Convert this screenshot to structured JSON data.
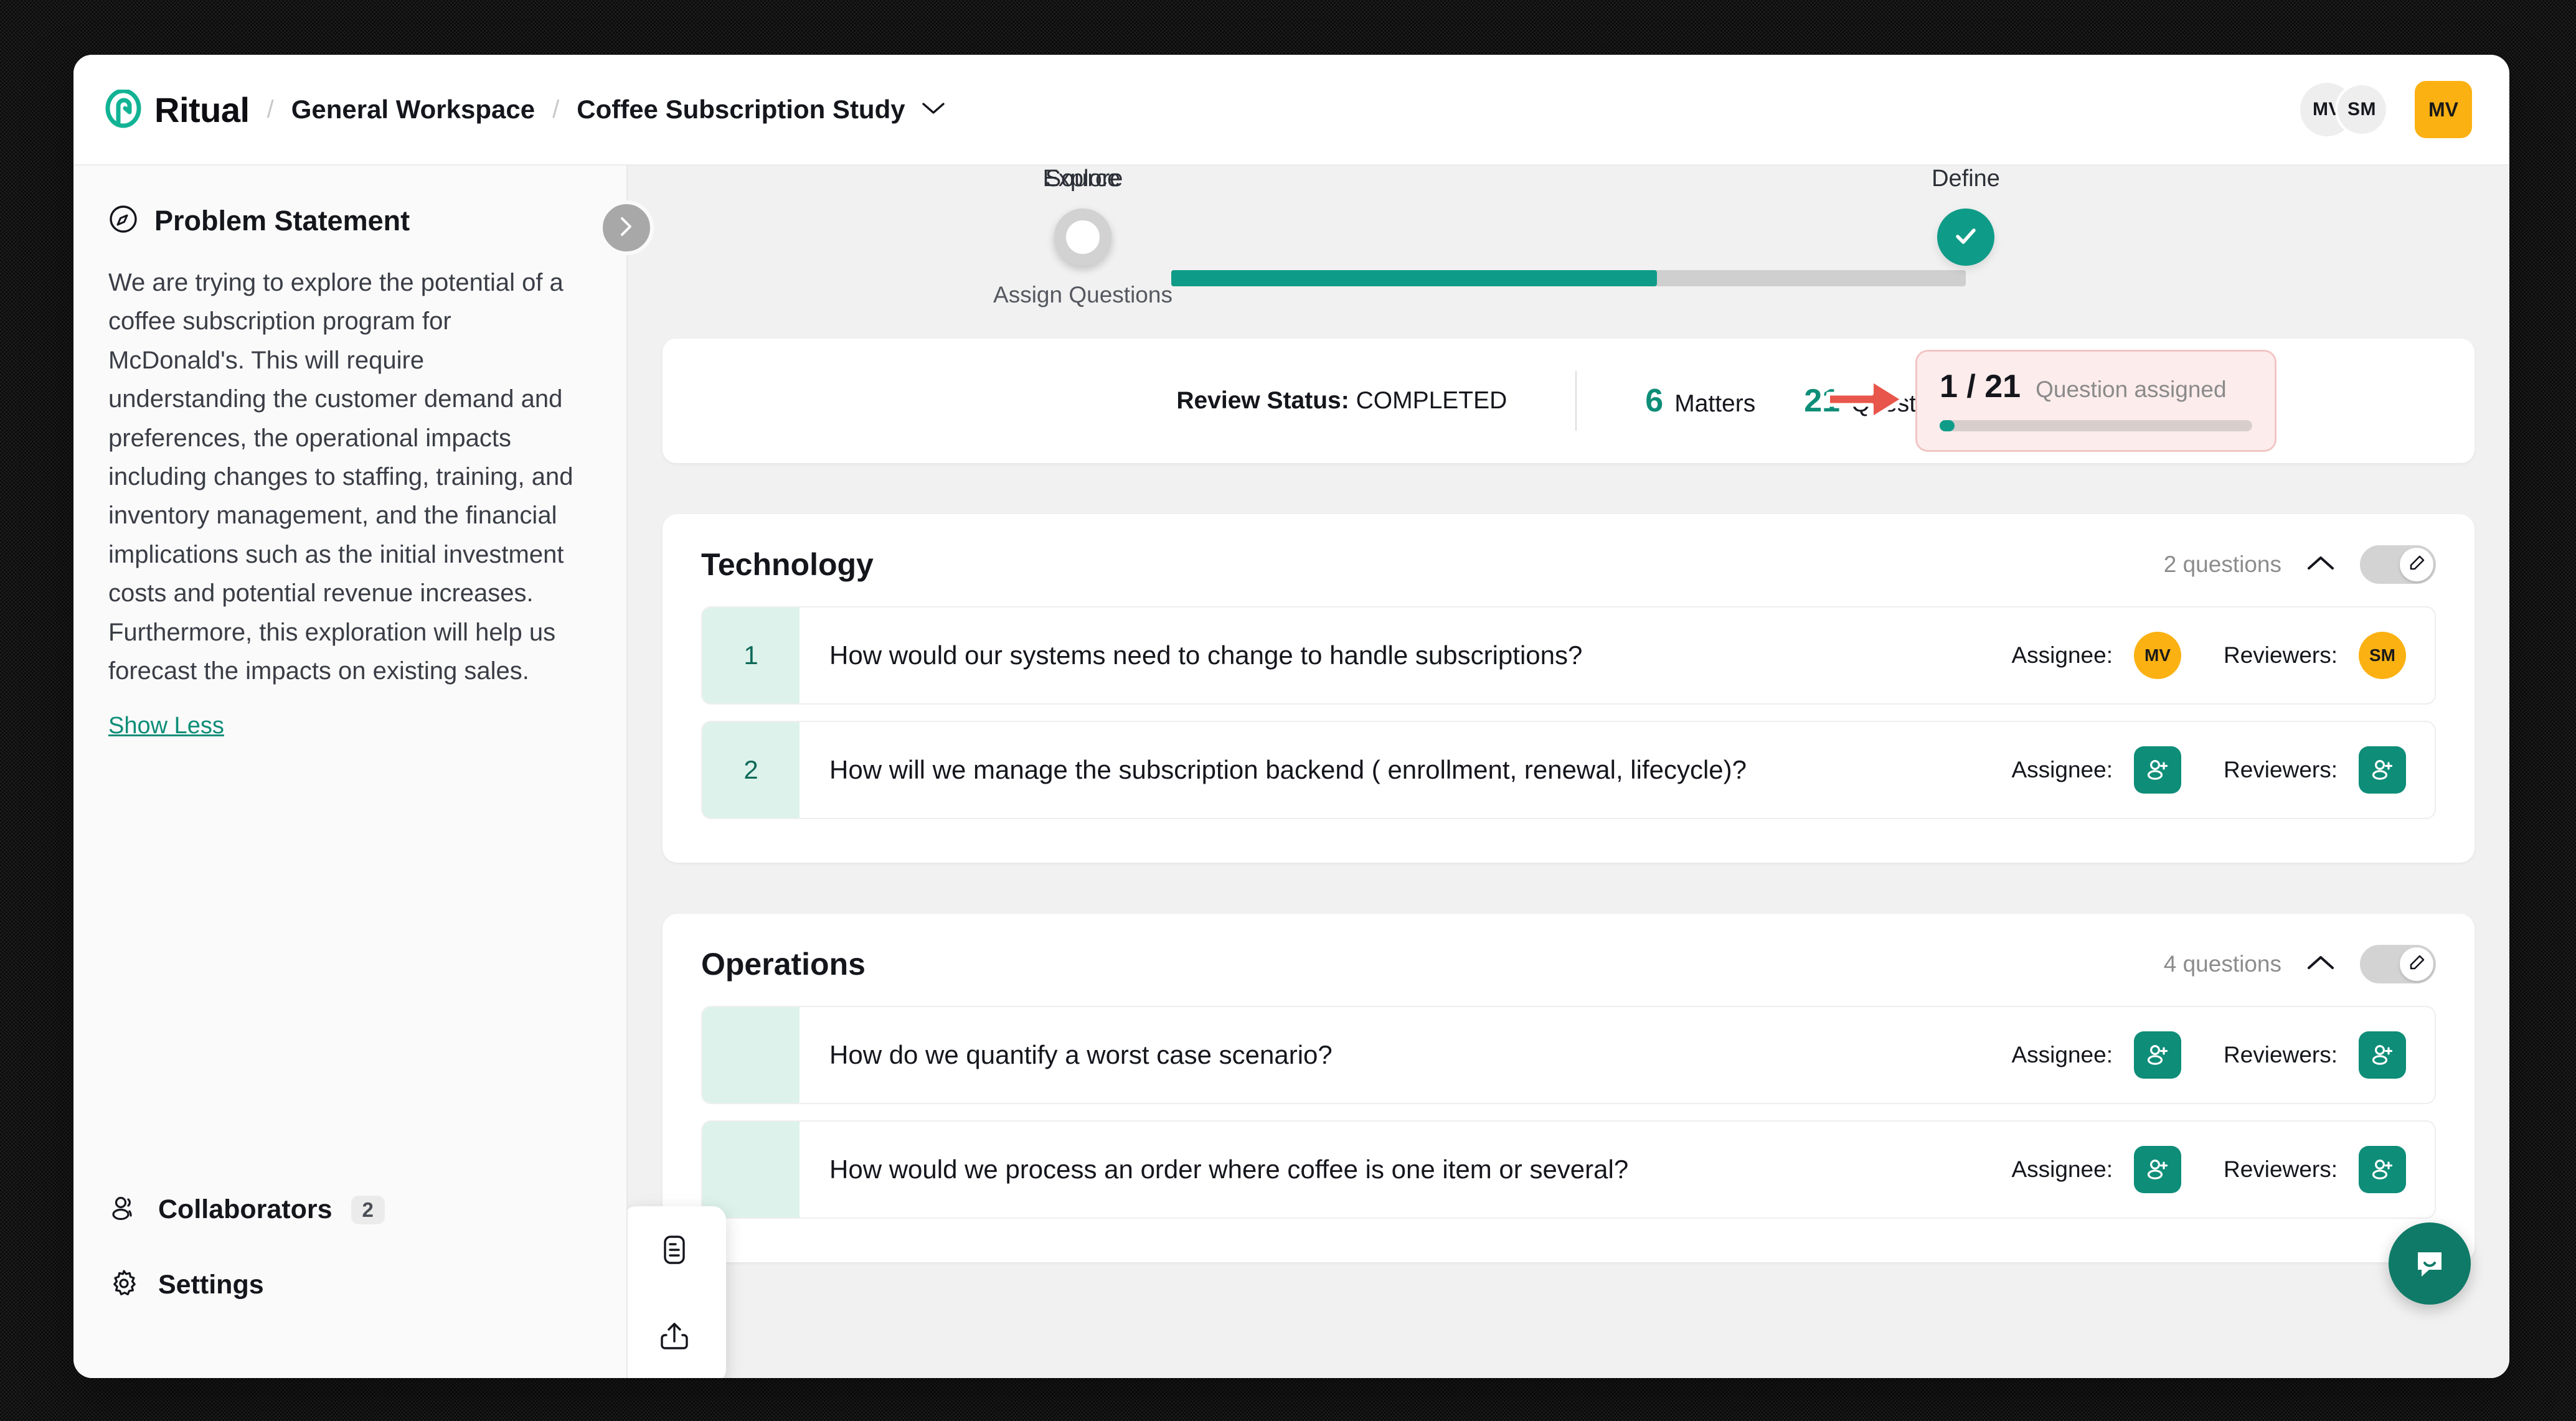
{
  "app": {
    "brand_name": "Ritual",
    "breadcrumb": [
      {
        "label": "General Workspace"
      },
      {
        "label": "Coffee Subscription Study"
      }
    ],
    "separator": "/"
  },
  "topbar": {
    "avatars": [
      {
        "initials": "MV"
      },
      {
        "initials": "SM"
      }
    ],
    "user_avatar": {
      "initials": "MV"
    }
  },
  "sidebar": {
    "title": "Problem Statement",
    "body": "We are trying to explore the potential of a coffee subscription program for McDonald's. This will require understanding the customer demand and preferences, the operational impacts including changes to staffing, training, and inventory management, and the financial implications such as the initial investment costs and potential revenue increases. Furthermore, this exploration will help us forecast the impacts on existing sales.",
    "show_toggle": "Show Less",
    "footer_items": [
      {
        "label": "Collaborators",
        "count": "2"
      },
      {
        "label": "Settings",
        "count": ""
      }
    ]
  },
  "stepper": {
    "steps": [
      {
        "label": "Define",
        "state": "done",
        "sub": ""
      },
      {
        "label": "Source",
        "state": "current",
        "sub": "Assign Questions"
      },
      {
        "label": "Explore",
        "state": "todo",
        "sub": ""
      }
    ]
  },
  "status_bar": {
    "review_label": "Review Status:",
    "review_value": "COMPLETED",
    "metrics": [
      {
        "value": "6",
        "label": "Matters"
      },
      {
        "value": "21",
        "label": "Questions"
      }
    ],
    "assigned": {
      "fraction": "1 / 21",
      "text": "Question assigned",
      "progress_percent": 4.7
    }
  },
  "sections": [
    {
      "title": "Technology",
      "count_label": "2 questions",
      "questions": [
        {
          "number": "1",
          "text": "How would our systems need to change to handle subscriptions?",
          "assignee_label": "Assignee:",
          "assignee": "MV",
          "assignee_type": "avatar",
          "reviewer_label": "Reviewers:",
          "reviewer": "SM",
          "reviewer_type": "avatar"
        },
        {
          "number": "2",
          "text": "How will we manage the subscription backend ( enrollment, renewal, lifecycle)?",
          "assignee_label": "Assignee:",
          "assignee": "",
          "assignee_type": "add",
          "reviewer_label": "Reviewers:",
          "reviewer": "",
          "reviewer_type": "add"
        }
      ]
    },
    {
      "title": "Operations",
      "count_label": "4 questions",
      "questions": [
        {
          "number": "",
          "text": "How do we quantify a worst case scenario?",
          "assignee_label": "Assignee:",
          "assignee": "",
          "assignee_type": "add",
          "reviewer_label": "Reviewers:",
          "reviewer": "",
          "reviewer_type": "add"
        },
        {
          "number": "",
          "text": "How would we process an order where coffee is one item or several?",
          "assignee_label": "Assignee:",
          "assignee": "",
          "assignee_type": "add",
          "reviewer_label": "Reviewers:",
          "reviewer": "",
          "reviewer_type": "add"
        }
      ]
    }
  ],
  "colors": {
    "brand_teal": "#0e8d78",
    "step_done": "#0e9c88",
    "step_current_halo": "#94f3e4",
    "avatar_yellow": "#fbb112",
    "highlight_pink_bg": "#fdecec",
    "highlight_pink_border": "#f2c5c5",
    "arrow_red": "#e8554a",
    "qnum_bg": "#ddf2ea"
  }
}
